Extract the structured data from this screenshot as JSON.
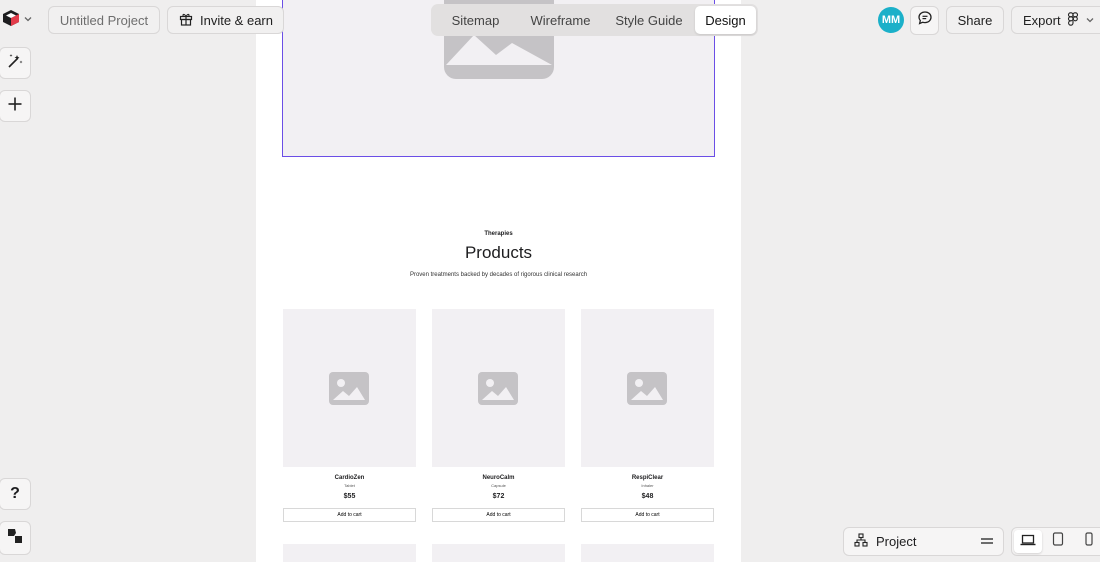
{
  "toolbar": {
    "project_name": "Untitled Project",
    "invite_label": "Invite & earn",
    "tabs": [
      {
        "label": "Sitemap"
      },
      {
        "label": "Wireframe"
      },
      {
        "label": "Style Guide"
      },
      {
        "label": "Design",
        "active": true
      }
    ],
    "avatar_initials": "MM",
    "share_label": "Share",
    "export_label": "Export"
  },
  "left_tools": {
    "help_label": "?"
  },
  "canvas": {
    "section": {
      "eyebrow": "Therapies",
      "title": "Products",
      "subtitle": "Proven treatments backed by decades of rigorous clinical research"
    },
    "products": [
      {
        "name": "CardioZen",
        "type": "Tablet",
        "price": "$55",
        "button": "Add to cart"
      },
      {
        "name": "NeuroCalm",
        "type": "Capsule",
        "price": "$72",
        "button": "Add to cart"
      },
      {
        "name": "RespiClear",
        "type": "Inhaler",
        "price": "$48",
        "button": "Add to cart"
      }
    ]
  },
  "bottom_bar": {
    "project_label": "Project"
  },
  "colors": {
    "accent_selection": "#6b4ee6",
    "avatar_bg": "#1bb0c9",
    "placeholder": "#c5c3c6"
  },
  "icons": [
    "logo-cube-icon",
    "chevron-down-icon",
    "gift-icon",
    "comment-icon",
    "figma-icon",
    "magic-wand-icon",
    "plus-icon",
    "help-icon",
    "feedback-icon",
    "sitemap-icon",
    "menu-icon",
    "desktop-icon",
    "tablet-icon",
    "mobile-icon",
    "image-placeholder-icon"
  ]
}
